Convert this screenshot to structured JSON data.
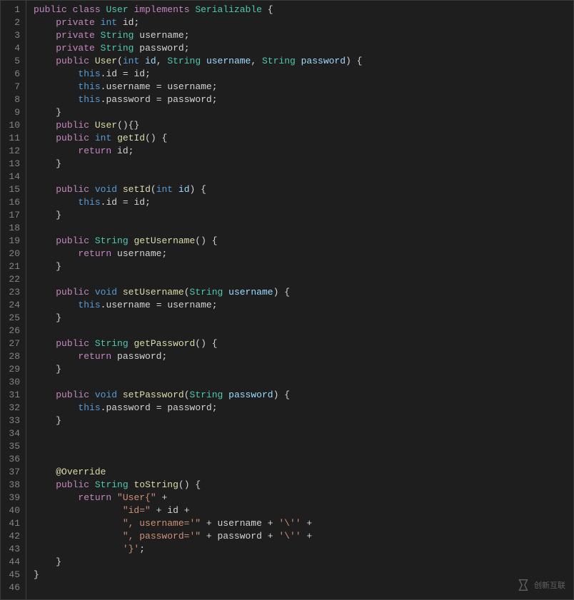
{
  "lines": [
    {
      "n": "1",
      "h": "<span class='kw'>public</span> <span class='kw'>class</span> <span class='cls'>User</span> <span class='kw'>implements</span> <span class='cls'>Serializable</span> <span class='punc'>{</span>"
    },
    {
      "n": "2",
      "h": "    <span class='kw'>private</span> <span class='type'>int</span> <span class='ident'>id</span><span class='punc'>;</span>"
    },
    {
      "n": "3",
      "h": "    <span class='kw'>private</span> <span class='cls'>String</span> <span class='ident'>username</span><span class='punc'>;</span>"
    },
    {
      "n": "4",
      "h": "    <span class='kw'>private</span> <span class='cls'>String</span> <span class='ident'>password</span><span class='punc'>;</span>"
    },
    {
      "n": "5",
      "h": "    <span class='kw'>public</span> <span class='fn'>User</span><span class='punc'>(</span><span class='type'>int</span> <span class='param'>id</span><span class='punc'>,</span> <span class='cls'>String</span> <span class='param'>username</span><span class='punc'>,</span> <span class='cls'>String</span> <span class='param'>password</span><span class='punc'>)</span> <span class='punc'>{</span>"
    },
    {
      "n": "6",
      "h": "        <span class='this'>this</span><span class='punc'>.</span><span class='ident'>id</span> <span class='op'>=</span> <span class='ident'>id</span><span class='punc'>;</span>"
    },
    {
      "n": "7",
      "h": "        <span class='this'>this</span><span class='punc'>.</span><span class='ident'>username</span> <span class='op'>=</span> <span class='ident'>username</span><span class='punc'>;</span>"
    },
    {
      "n": "8",
      "h": "        <span class='this'>this</span><span class='punc'>.</span><span class='ident'>password</span> <span class='op'>=</span> <span class='ident'>password</span><span class='punc'>;</span>"
    },
    {
      "n": "9",
      "h": "    <span class='punc'>}</span>"
    },
    {
      "n": "10",
      "h": "    <span class='kw'>public</span> <span class='fn'>User</span><span class='punc'>(){}</span>"
    },
    {
      "n": "11",
      "h": "    <span class='kw'>public</span> <span class='type'>int</span> <span class='fn'>getId</span><span class='punc'>()</span> <span class='punc'>{</span>"
    },
    {
      "n": "12",
      "h": "        <span class='kw'>return</span> <span class='ident'>id</span><span class='punc'>;</span>"
    },
    {
      "n": "13",
      "h": "    <span class='punc'>}</span>"
    },
    {
      "n": "14",
      "h": ""
    },
    {
      "n": "15",
      "h": "    <span class='kw'>public</span> <span class='type'>void</span> <span class='fn'>setId</span><span class='punc'>(</span><span class='type'>int</span> <span class='param'>id</span><span class='punc'>)</span> <span class='punc'>{</span>"
    },
    {
      "n": "16",
      "h": "        <span class='this'>this</span><span class='punc'>.</span><span class='ident'>id</span> <span class='op'>=</span> <span class='ident'>id</span><span class='punc'>;</span>"
    },
    {
      "n": "17",
      "h": "    <span class='punc'>}</span>"
    },
    {
      "n": "18",
      "h": ""
    },
    {
      "n": "19",
      "h": "    <span class='kw'>public</span> <span class='cls'>String</span> <span class='fn'>getUsername</span><span class='punc'>()</span> <span class='punc'>{</span>"
    },
    {
      "n": "20",
      "h": "        <span class='kw'>return</span> <span class='ident'>username</span><span class='punc'>;</span>"
    },
    {
      "n": "21",
      "h": "    <span class='punc'>}</span>"
    },
    {
      "n": "22",
      "h": ""
    },
    {
      "n": "23",
      "h": "    <span class='kw'>public</span> <span class='type'>void</span> <span class='fn'>setUsername</span><span class='punc'>(</span><span class='cls'>String</span> <span class='param'>username</span><span class='punc'>)</span> <span class='punc'>{</span>"
    },
    {
      "n": "24",
      "h": "        <span class='this'>this</span><span class='punc'>.</span><span class='ident'>username</span> <span class='op'>=</span> <span class='ident'>username</span><span class='punc'>;</span>"
    },
    {
      "n": "25",
      "h": "    <span class='punc'>}</span>"
    },
    {
      "n": "26",
      "h": ""
    },
    {
      "n": "27",
      "h": "    <span class='kw'>public</span> <span class='cls'>String</span> <span class='fn'>getPassword</span><span class='punc'>()</span> <span class='punc'>{</span>"
    },
    {
      "n": "28",
      "h": "        <span class='kw'>return</span> <span class='ident'>password</span><span class='punc'>;</span>"
    },
    {
      "n": "29",
      "h": "    <span class='punc'>}</span>"
    },
    {
      "n": "30",
      "h": ""
    },
    {
      "n": "31",
      "h": "    <span class='kw'>public</span> <span class='type'>void</span> <span class='fn'>setPassword</span><span class='punc'>(</span><span class='cls'>String</span> <span class='param'>password</span><span class='punc'>)</span> <span class='punc'>{</span>"
    },
    {
      "n": "32",
      "h": "        <span class='this'>this</span><span class='punc'>.</span><span class='ident'>password</span> <span class='op'>=</span> <span class='ident'>password</span><span class='punc'>;</span>"
    },
    {
      "n": "33",
      "h": "    <span class='punc'>}</span>"
    },
    {
      "n": "34",
      "h": ""
    },
    {
      "n": "35",
      "h": ""
    },
    {
      "n": "36",
      "h": ""
    },
    {
      "n": "37",
      "h": "    <span class='ann'>@Override</span>"
    },
    {
      "n": "38",
      "h": "    <span class='kw'>public</span> <span class='cls'>String</span> <span class='fn'>toString</span><span class='punc'>()</span> <span class='punc'>{</span>"
    },
    {
      "n": "39",
      "h": "        <span class='kw'>return</span> <span class='str'>\"User{\"</span> <span class='op'>+</span>"
    },
    {
      "n": "40",
      "h": "                <span class='str'>\"id=\"</span> <span class='op'>+</span> <span class='ident'>id</span> <span class='op'>+</span>"
    },
    {
      "n": "41",
      "h": "                <span class='str'>\", username='\"</span> <span class='op'>+</span> <span class='ident'>username</span> <span class='op'>+</span> <span class='str'>'\\''</span> <span class='op'>+</span>"
    },
    {
      "n": "42",
      "h": "                <span class='str'>\", password='\"</span> <span class='op'>+</span> <span class='ident'>password</span> <span class='op'>+</span> <span class='str'>'\\''</span> <span class='op'>+</span>"
    },
    {
      "n": "43",
      "h": "                <span class='str'>'}'</span><span class='punc'>;</span>"
    },
    {
      "n": "44",
      "h": "    <span class='punc'>}</span>"
    },
    {
      "n": "45",
      "h": "<span class='punc'>}</span>"
    },
    {
      "n": "46",
      "h": ""
    }
  ],
  "watermark": "创新互联"
}
